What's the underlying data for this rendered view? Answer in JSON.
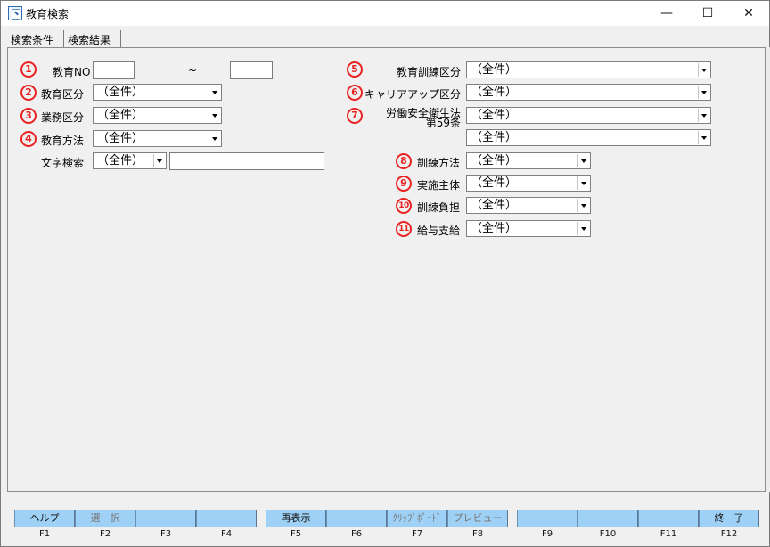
{
  "window": {
    "title": "教育検索",
    "minimize_glyph": "—",
    "maximize_glyph": "☐",
    "close_glyph": "✕"
  },
  "tabs": [
    {
      "label": "検索条件"
    },
    {
      "label": "検索結果"
    }
  ],
  "numbers": {
    "n1": "1",
    "n2": "2",
    "n3": "3",
    "n4": "4",
    "n5": "5",
    "n6": "6",
    "n7": "7",
    "n8": "8",
    "n9": "9",
    "n10": "10",
    "n11": "11"
  },
  "fields": {
    "education_no": {
      "label": "教育NO",
      "from_value": "",
      "to_value": "",
      "range_separator": "~"
    },
    "education_category": {
      "label": "教育区分",
      "selected": "（全件）"
    },
    "business_category": {
      "label": "業務区分",
      "selected": "（全件）"
    },
    "education_method": {
      "label": "教育方法",
      "selected": "（全件）"
    },
    "text_search": {
      "label": "文字検索",
      "selected": "（全件）",
      "value": ""
    },
    "training_category": {
      "label": "教育訓練区分",
      "selected": "（全件）"
    },
    "career_up_category": {
      "label": "キャリアアップ区分",
      "selected": "（全件）"
    },
    "labor_safety_law": {
      "label_line1": "労働安全衛生法",
      "label_line2": "第59条",
      "selected_1": "（全件）",
      "selected_2": "（全件）"
    },
    "training_method": {
      "label": "訓練方法",
      "selected": "（全件）"
    },
    "implementing_body": {
      "label": "実施主体",
      "selected": "（全件）"
    },
    "training_burden": {
      "label": "訓練負担",
      "selected": "（全件）"
    },
    "salary_payment": {
      "label": "給与支給",
      "selected": "（全件）"
    }
  },
  "function_keys": [
    {
      "button": "ヘルプ",
      "key": "F1"
    },
    {
      "button": "選　択",
      "key": "F2"
    },
    {
      "button": "",
      "key": "F3"
    },
    {
      "button": "",
      "key": "F4"
    },
    {
      "button": "再表示",
      "key": "F5"
    },
    {
      "button": "",
      "key": "F6"
    },
    {
      "button": "ｸﾘｯﾌﾟﾎﾞｰﾄﾞ",
      "key": "F7"
    },
    {
      "button": "プレビュー",
      "key": "F8"
    },
    {
      "button": "",
      "key": "F9"
    },
    {
      "button": "",
      "key": "F10"
    },
    {
      "button": "",
      "key": "F11"
    },
    {
      "button": "終　了",
      "key": "F12"
    }
  ]
}
